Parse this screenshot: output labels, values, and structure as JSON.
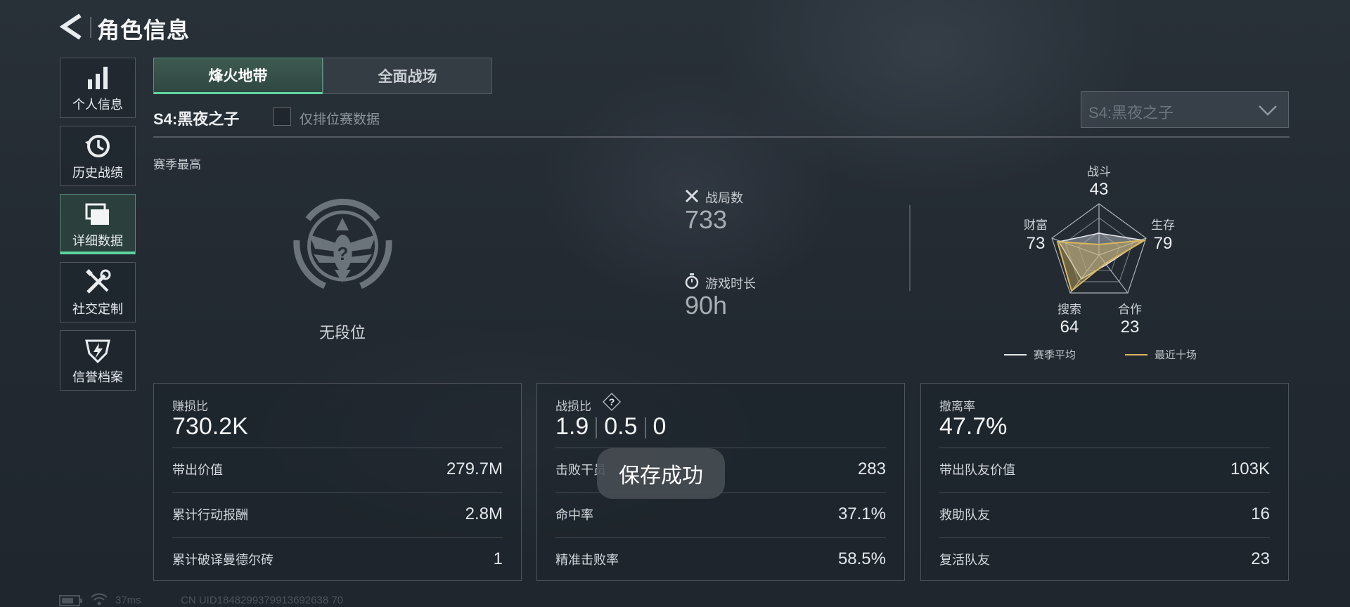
{
  "header": {
    "title": "角色信息"
  },
  "sidebar": {
    "items": [
      {
        "label": "个人信息",
        "icon": "bar-chart-icon"
      },
      {
        "label": "历史战绩",
        "icon": "history-clock-icon"
      },
      {
        "label": "详细数据",
        "icon": "folder-icon",
        "active": true
      },
      {
        "label": "社交定制",
        "icon": "tools-icon"
      },
      {
        "label": "信誉档案",
        "icon": "shield-icon"
      }
    ]
  },
  "tabs": [
    {
      "label": "烽火地带",
      "active": true
    },
    {
      "label": "全面战场",
      "active": false
    }
  ],
  "season": {
    "label": "S4:黑夜之子",
    "ranked_only_label": "仅排位赛数据",
    "ranked_only_checked": false,
    "select_value": "S4:黑夜之子"
  },
  "overview": {
    "season_best_label": "赛季最高",
    "rank_name": "无段位",
    "battles_label": "战局数",
    "battles_value": "733",
    "playtime_label": "游戏时长",
    "playtime_value": "90h"
  },
  "radar": {
    "axes": [
      {
        "label": "战斗",
        "value": "43"
      },
      {
        "label": "生存",
        "value": "79"
      },
      {
        "label": "合作",
        "value": "23"
      },
      {
        "label": "搜索",
        "value": "64"
      },
      {
        "label": "财富",
        "value": "73"
      }
    ],
    "legend": [
      {
        "label": "赛季平均",
        "color": "#e6e8ea"
      },
      {
        "label": "最近十场",
        "color": "#d9b75c"
      }
    ]
  },
  "cards": {
    "profit": {
      "title": "赚损比",
      "main": "730.2K",
      "rows": [
        {
          "label": "带出价值",
          "value": "279.7M"
        },
        {
          "label": "累计行动报酬",
          "value": "2.8M"
        },
        {
          "label": "累计破译曼德尔砖",
          "value": "1"
        }
      ]
    },
    "combat": {
      "title": "战损比",
      "main_parts": [
        "1.9",
        "0.5",
        "0"
      ],
      "rows": [
        {
          "label": "击败干员",
          "value": "283"
        },
        {
          "label": "命中率",
          "value": "37.1%"
        },
        {
          "label": "精准击败率",
          "value": "58.5%"
        }
      ]
    },
    "extract": {
      "title": "撤离率",
      "main": "47.7%",
      "rows": [
        {
          "label": "带出队友价值",
          "value": "103K"
        },
        {
          "label": "救助队友",
          "value": "16"
        },
        {
          "label": "复活队友",
          "value": "23"
        }
      ]
    }
  },
  "toast": {
    "text": "保存成功"
  },
  "status": {
    "ping": "37ms",
    "uid": "CN UID1848299379913692638 70"
  }
}
